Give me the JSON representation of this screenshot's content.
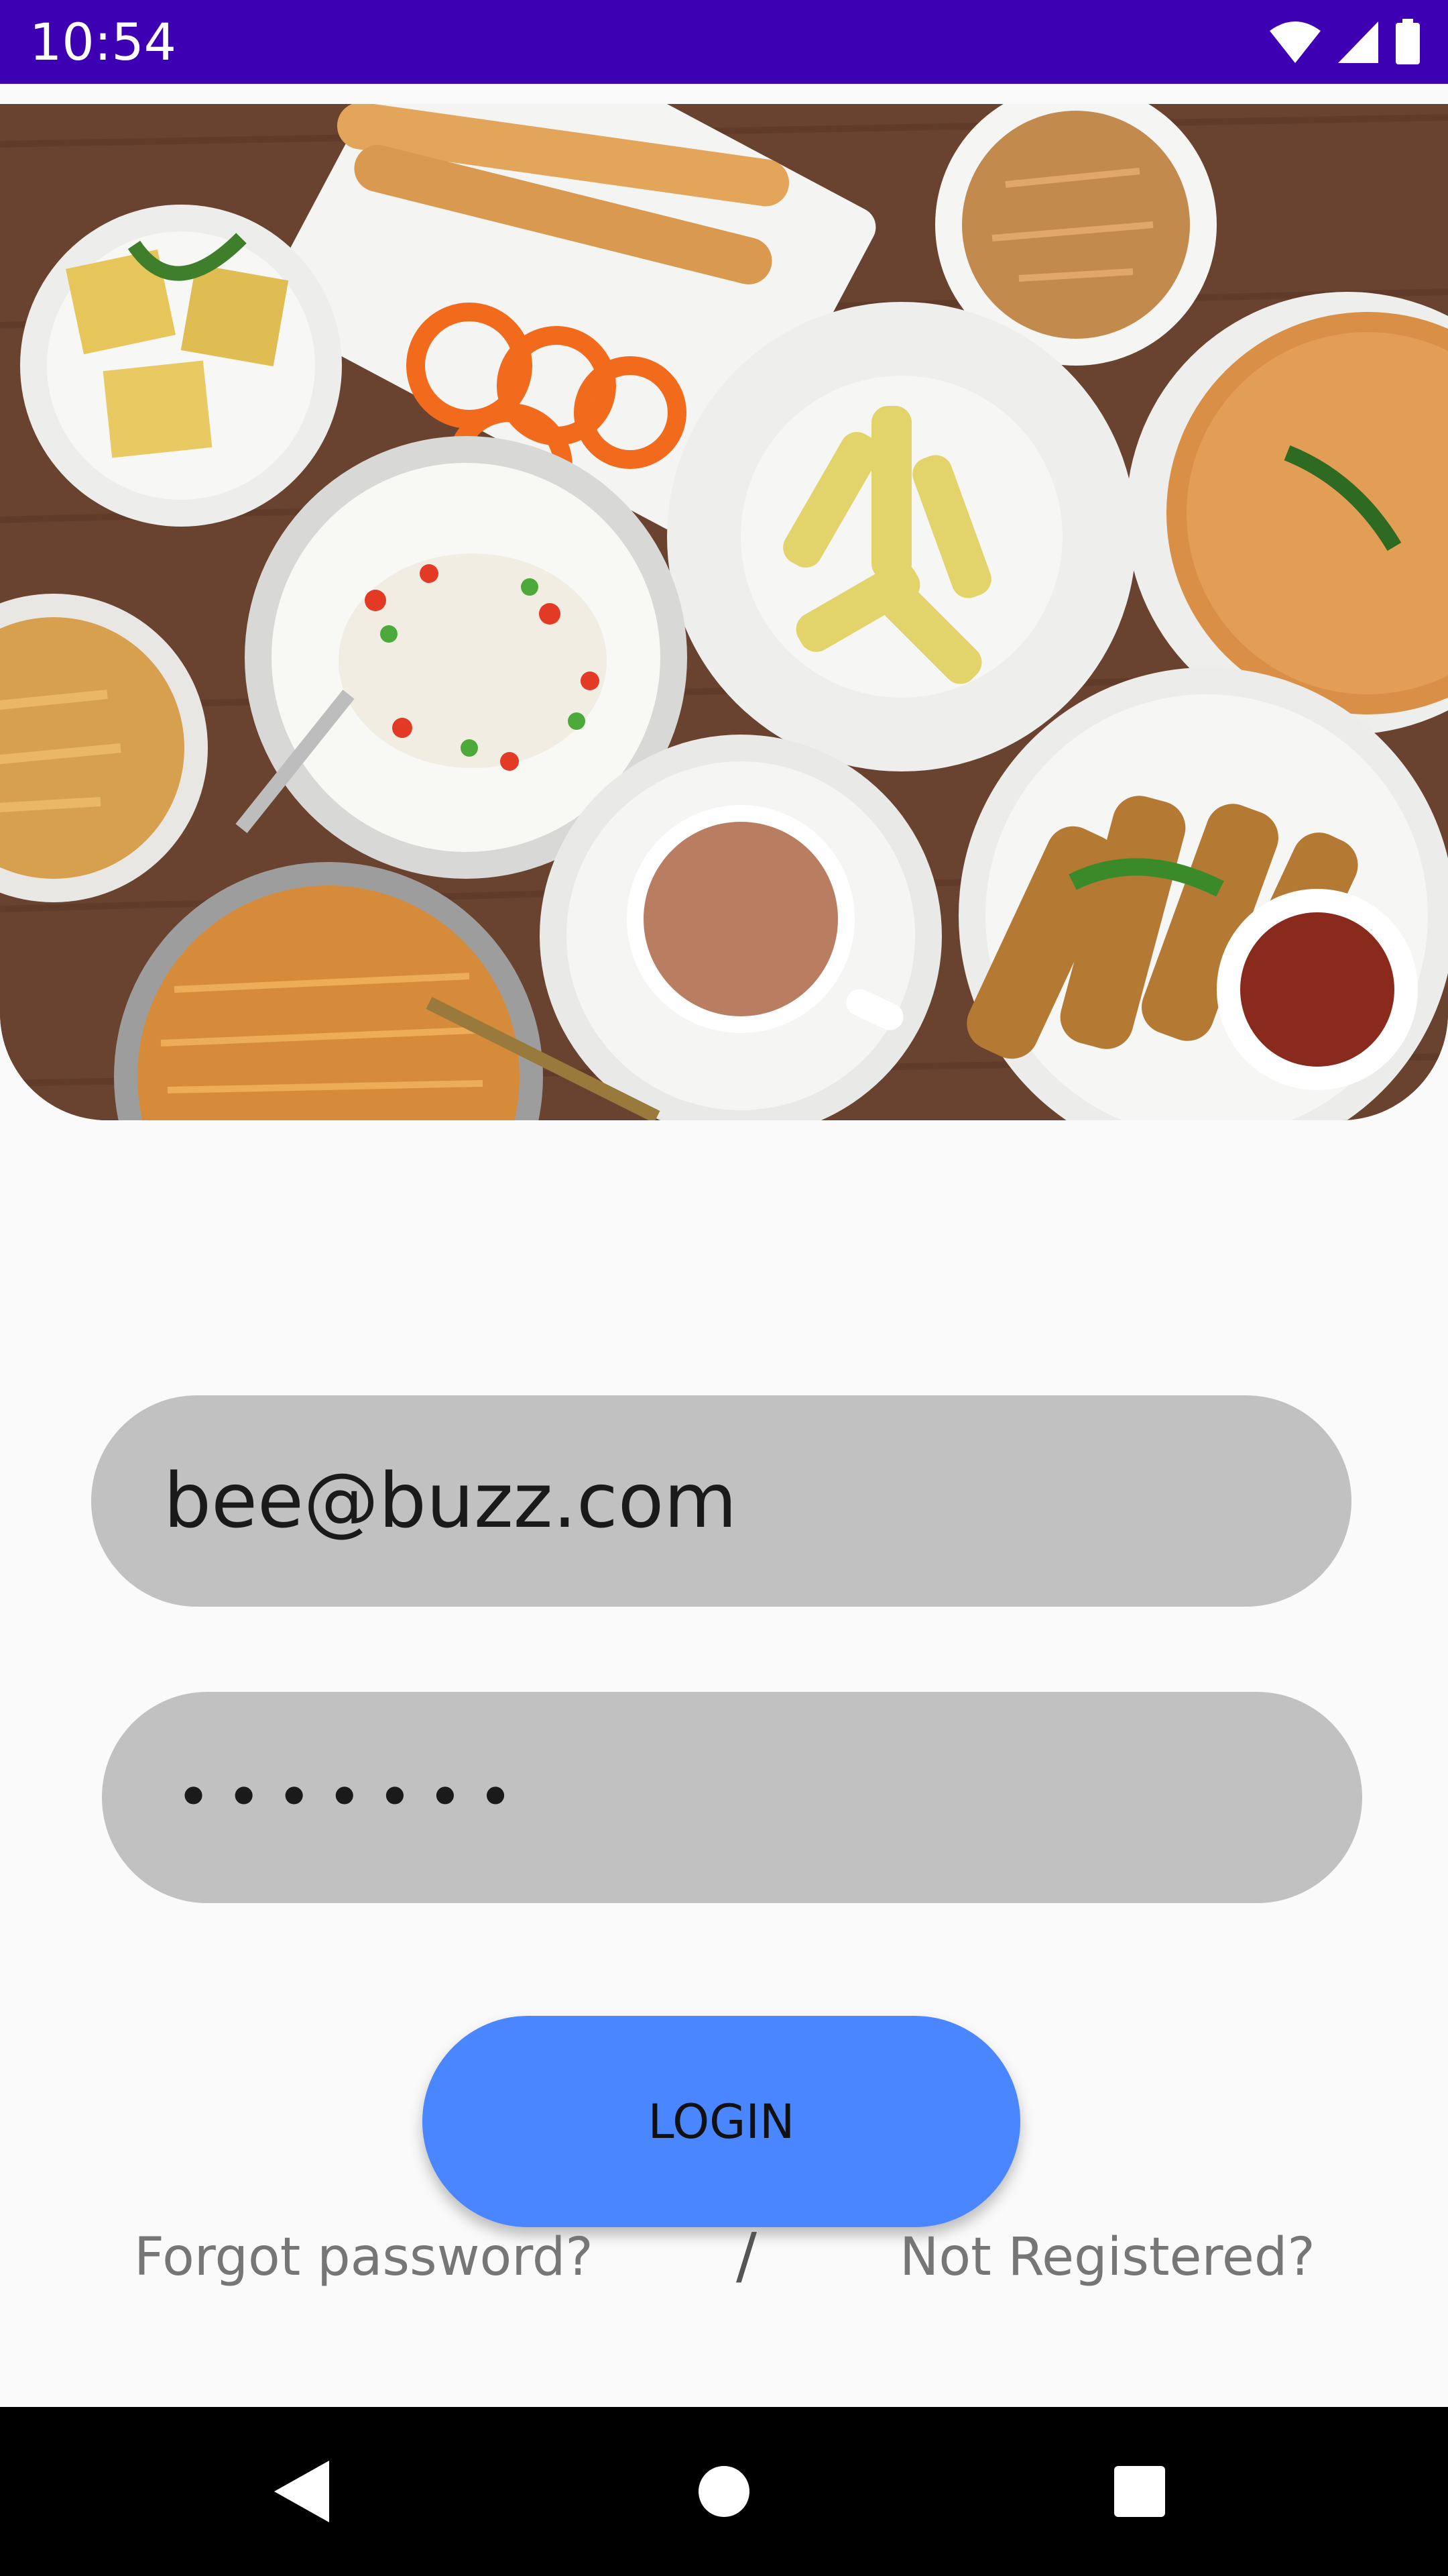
{
  "status_bar": {
    "time": "10:54",
    "icons": [
      "wifi-icon",
      "cell-signal-icon",
      "battery-icon"
    ],
    "background": "#3e00b3"
  },
  "hero": {
    "image": "indian-snacks-food-platter"
  },
  "login_form": {
    "email_value": "bee@buzz.com",
    "password_mask": "•••••••",
    "login_label": "LOGIN",
    "forgot_label": "Forgot password?",
    "separator": "/",
    "register_label": "Not Registered?",
    "input_color": "#c1c1c1",
    "button_color": "#4a86ff"
  },
  "nav_bar": {
    "icons": [
      "back-triangle-icon",
      "home-circle-icon",
      "recents-square-icon"
    ]
  }
}
